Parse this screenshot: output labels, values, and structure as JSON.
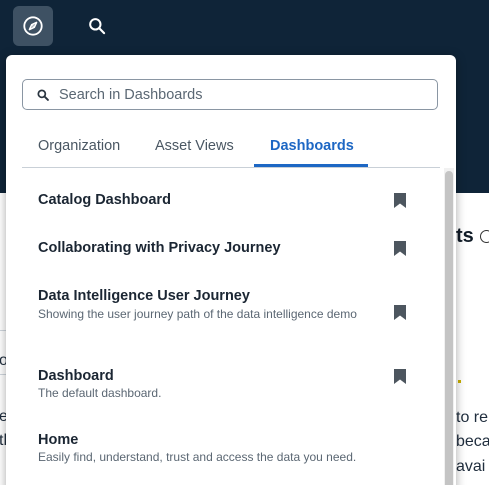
{
  "topbar": {
    "nav_icon": "compass-icon",
    "search_icon": "search-icon"
  },
  "background": {
    "title_fragment": "ts",
    "line1": "to re",
    "line2": "beca",
    "line3": "avai",
    "left_e": "e",
    "left_th": "th",
    "left_o": "o"
  },
  "popover": {
    "search": {
      "placeholder": "Search in Dashboards",
      "value": ""
    },
    "tabs": [
      {
        "label": "Organization",
        "active": false
      },
      {
        "label": "Asset Views",
        "active": false
      },
      {
        "label": "Dashboards",
        "active": true
      }
    ],
    "items": [
      {
        "title": "Catalog Dashboard",
        "description": "",
        "bookmarked": true
      },
      {
        "title": "Collaborating with Privacy Journey",
        "description": "",
        "bookmarked": true
      },
      {
        "title": "Data Intelligence User Journey",
        "description": "Showing the user journey path of the data intelligence demo",
        "bookmarked": true
      },
      {
        "title": "Dashboard",
        "description": "The default dashboard.",
        "bookmarked": true
      },
      {
        "title": "Home",
        "description": "Easily find, understand, trust and access the data you need.",
        "bookmarked": false
      }
    ]
  },
  "colors": {
    "topbar": "#0f2438",
    "accent": "#1d67c4"
  }
}
